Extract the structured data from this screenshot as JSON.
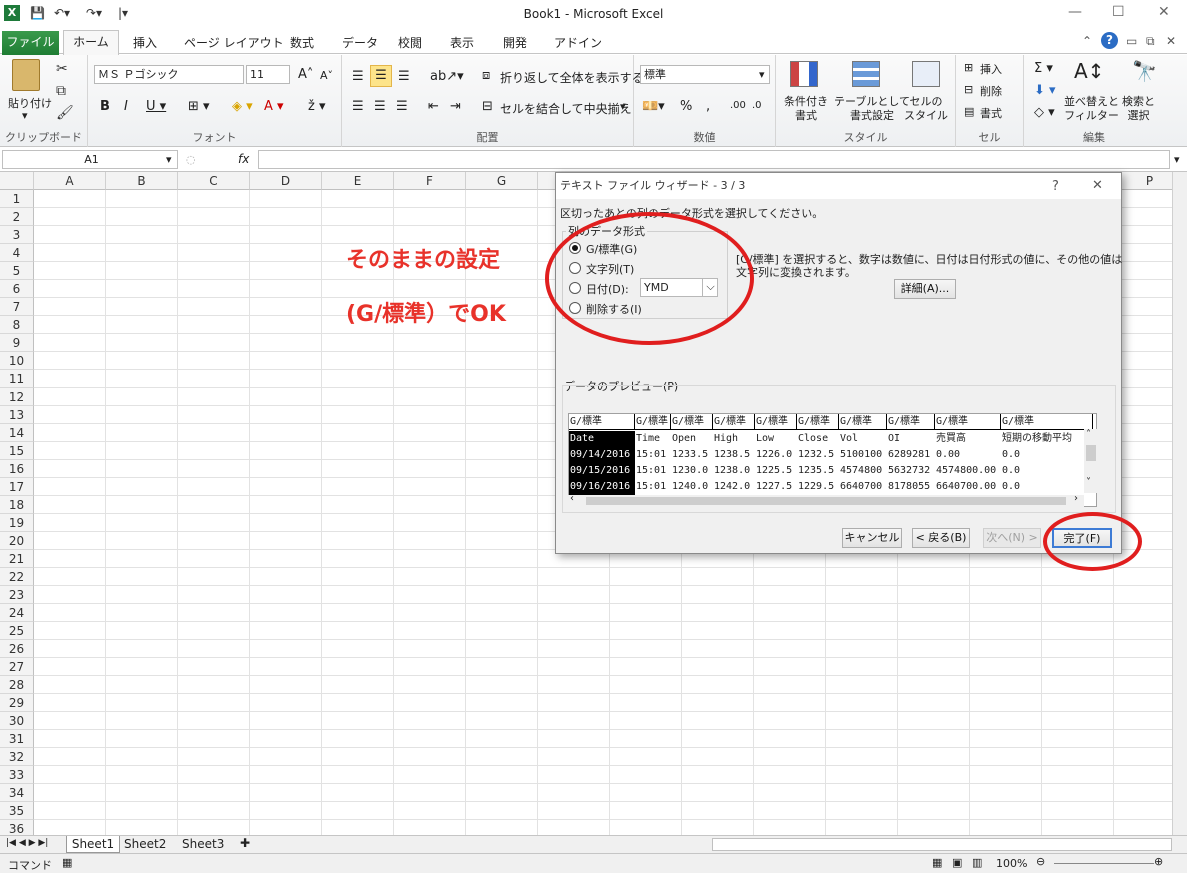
{
  "window": {
    "title": "Book1 - Microsoft Excel"
  },
  "tabs": [
    "ファイル",
    "ホーム",
    "挿入",
    "ページ レイアウト",
    "数式",
    "データ",
    "校閲",
    "表示",
    "開発",
    "アドイン"
  ],
  "ribbon": {
    "clipboard": {
      "paste": "貼り付け",
      "label": "クリップボード"
    },
    "font": {
      "name": "ＭＳ Ｐゴシック",
      "size": "11",
      "label": "フォント"
    },
    "align": {
      "wrap": "折り返して全体を表示する",
      "merge": "セルを結合して中央揃え",
      "label": "配置"
    },
    "number": {
      "format": "標準",
      "label": "数値"
    },
    "style": {
      "cond": "条件付き\n書式",
      "table": "テーブルとして\n書式設定",
      "cell": "セルの\nスタイル",
      "label": "スタイル"
    },
    "cells": {
      "insert": "挿入",
      "delete": "削除",
      "format": "書式",
      "label": "セル"
    },
    "edit": {
      "sort": "並べ替えと\nフィルター",
      "find": "検索と\n選択",
      "label": "編集"
    }
  },
  "formula": {
    "namebox": "A1",
    "fx": "fx"
  },
  "columns": [
    "A",
    "B",
    "C",
    "D",
    "E",
    "F",
    "G",
    "H",
    "I",
    "J",
    "K",
    "L",
    "M",
    "N",
    "O",
    "P"
  ],
  "rows": [
    "1",
    "2",
    "3",
    "4",
    "5",
    "6",
    "7",
    "8",
    "9",
    "10",
    "11",
    "12",
    "13",
    "14",
    "15",
    "16",
    "17",
    "18",
    "19",
    "20",
    "21",
    "22",
    "23",
    "24",
    "25",
    "26",
    "27",
    "28",
    "29",
    "30",
    "31",
    "32",
    "33",
    "34",
    "35",
    "36"
  ],
  "sheets": [
    "Sheet1",
    "Sheet2",
    "Sheet3"
  ],
  "status": {
    "mode": "コマンド",
    "zoom": "100%"
  },
  "annotation": {
    "line1": "そのままの設定",
    "line2": "(G/標準）でOK"
  },
  "dialog": {
    "title": "テキスト ファイル ウィザード - 3 / 3",
    "help": "?",
    "close": "✕",
    "instruction": "区切ったあとの列のデータ形式を選択してください。",
    "group_label": "列のデータ形式",
    "options": [
      "G/標準(G)",
      "文字列(T)",
      "日付(D):",
      "削除する(I)"
    ],
    "date_format": "YMD",
    "description_line1": "[G/標準] を選択すると、数字は数値に、日付は日付形式の値に、その他の値は",
    "description_line2": "文字列に変換されます。",
    "advanced": "詳細(A)...",
    "preview_label": "データのプレビュー(P)",
    "preview": {
      "header": [
        "G/標準",
        "G/標準",
        "G/標準",
        "G/標準",
        "G/標準",
        "G/標準",
        "G/標準",
        "G/標準",
        "G/標準",
        "G/標準"
      ],
      "rows": [
        [
          "Date",
          "Time",
          "Open",
          "High",
          "Low",
          "Close",
          "Vol",
          "OI",
          "売買高",
          "短期の移動平均"
        ],
        [
          "09/14/2016",
          "15:01",
          "1233.5",
          "1238.5",
          "1226.0",
          "1232.5",
          "5100100",
          "6289281",
          "0.00",
          "0.0"
        ],
        [
          "09/15/2016",
          "15:01",
          "1230.0",
          "1238.0",
          "1225.5",
          "1235.5",
          "4574800",
          "5632732",
          "4574800.00",
          "0.0"
        ],
        [
          "09/16/2016",
          "15:01",
          "1240.0",
          "1242.0",
          "1227.5",
          "1229.5",
          "6640700",
          "8178055",
          "6640700.00",
          "0.0"
        ]
      ]
    },
    "buttons": {
      "cancel": "キャンセル",
      "back": "< 戻る(B)",
      "next": "次へ(N) >",
      "finish": "完了(F)"
    }
  }
}
